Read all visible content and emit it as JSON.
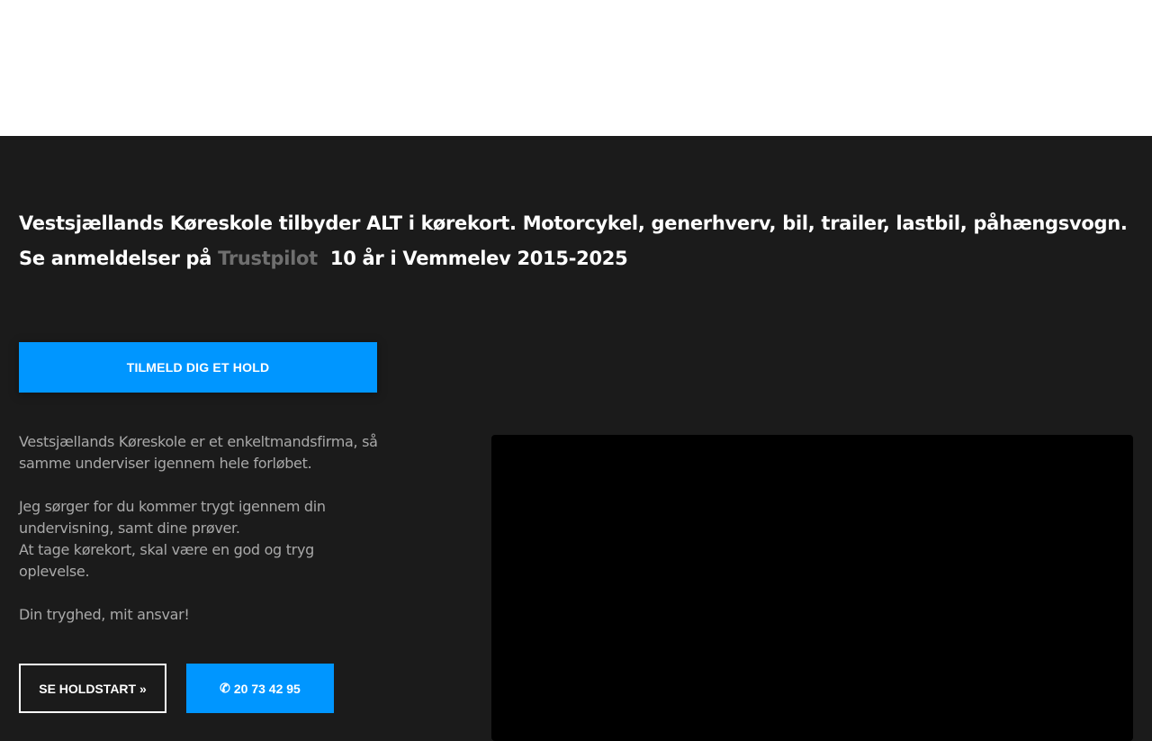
{
  "hero": {
    "headline_line1": "Vestsjællands Køreskole tilbyder ALT i kørekort. Motorcykel, generhverv, bil, trailer, lastbil, påhængsvogn.",
    "headline_line2_prefix": "Se anmeldelser på",
    "trustpilot_link": "Trustpilot",
    "headline_line2_suffix": "10 år i Vemmelev 2015-2025",
    "signup_button": "TILMELD DIG ET HOLD",
    "paragraphs": [
      "Vestsjællands Køreskole er et enkeltmandsfirma, så samme underviser igennem hele forløbet.",
      "Jeg sørger for du kommer trygt igennem din undervisning, samt dine prøver.",
      "At tage kørekort, skal være en god og tryg oplevelse.",
      "Din tryghed, mit ansvar!"
    ],
    "holdstart_button": "SE HOLDSTART »",
    "phone_icon": "phone-icon",
    "phone_symbol": "✆",
    "phone_number": "20 73 42 95"
  },
  "colors": {
    "background": "#1b1b1b",
    "accent": "#0096ff",
    "muted_link": "#6f6f6f",
    "body_text": "#a9a9a9"
  }
}
